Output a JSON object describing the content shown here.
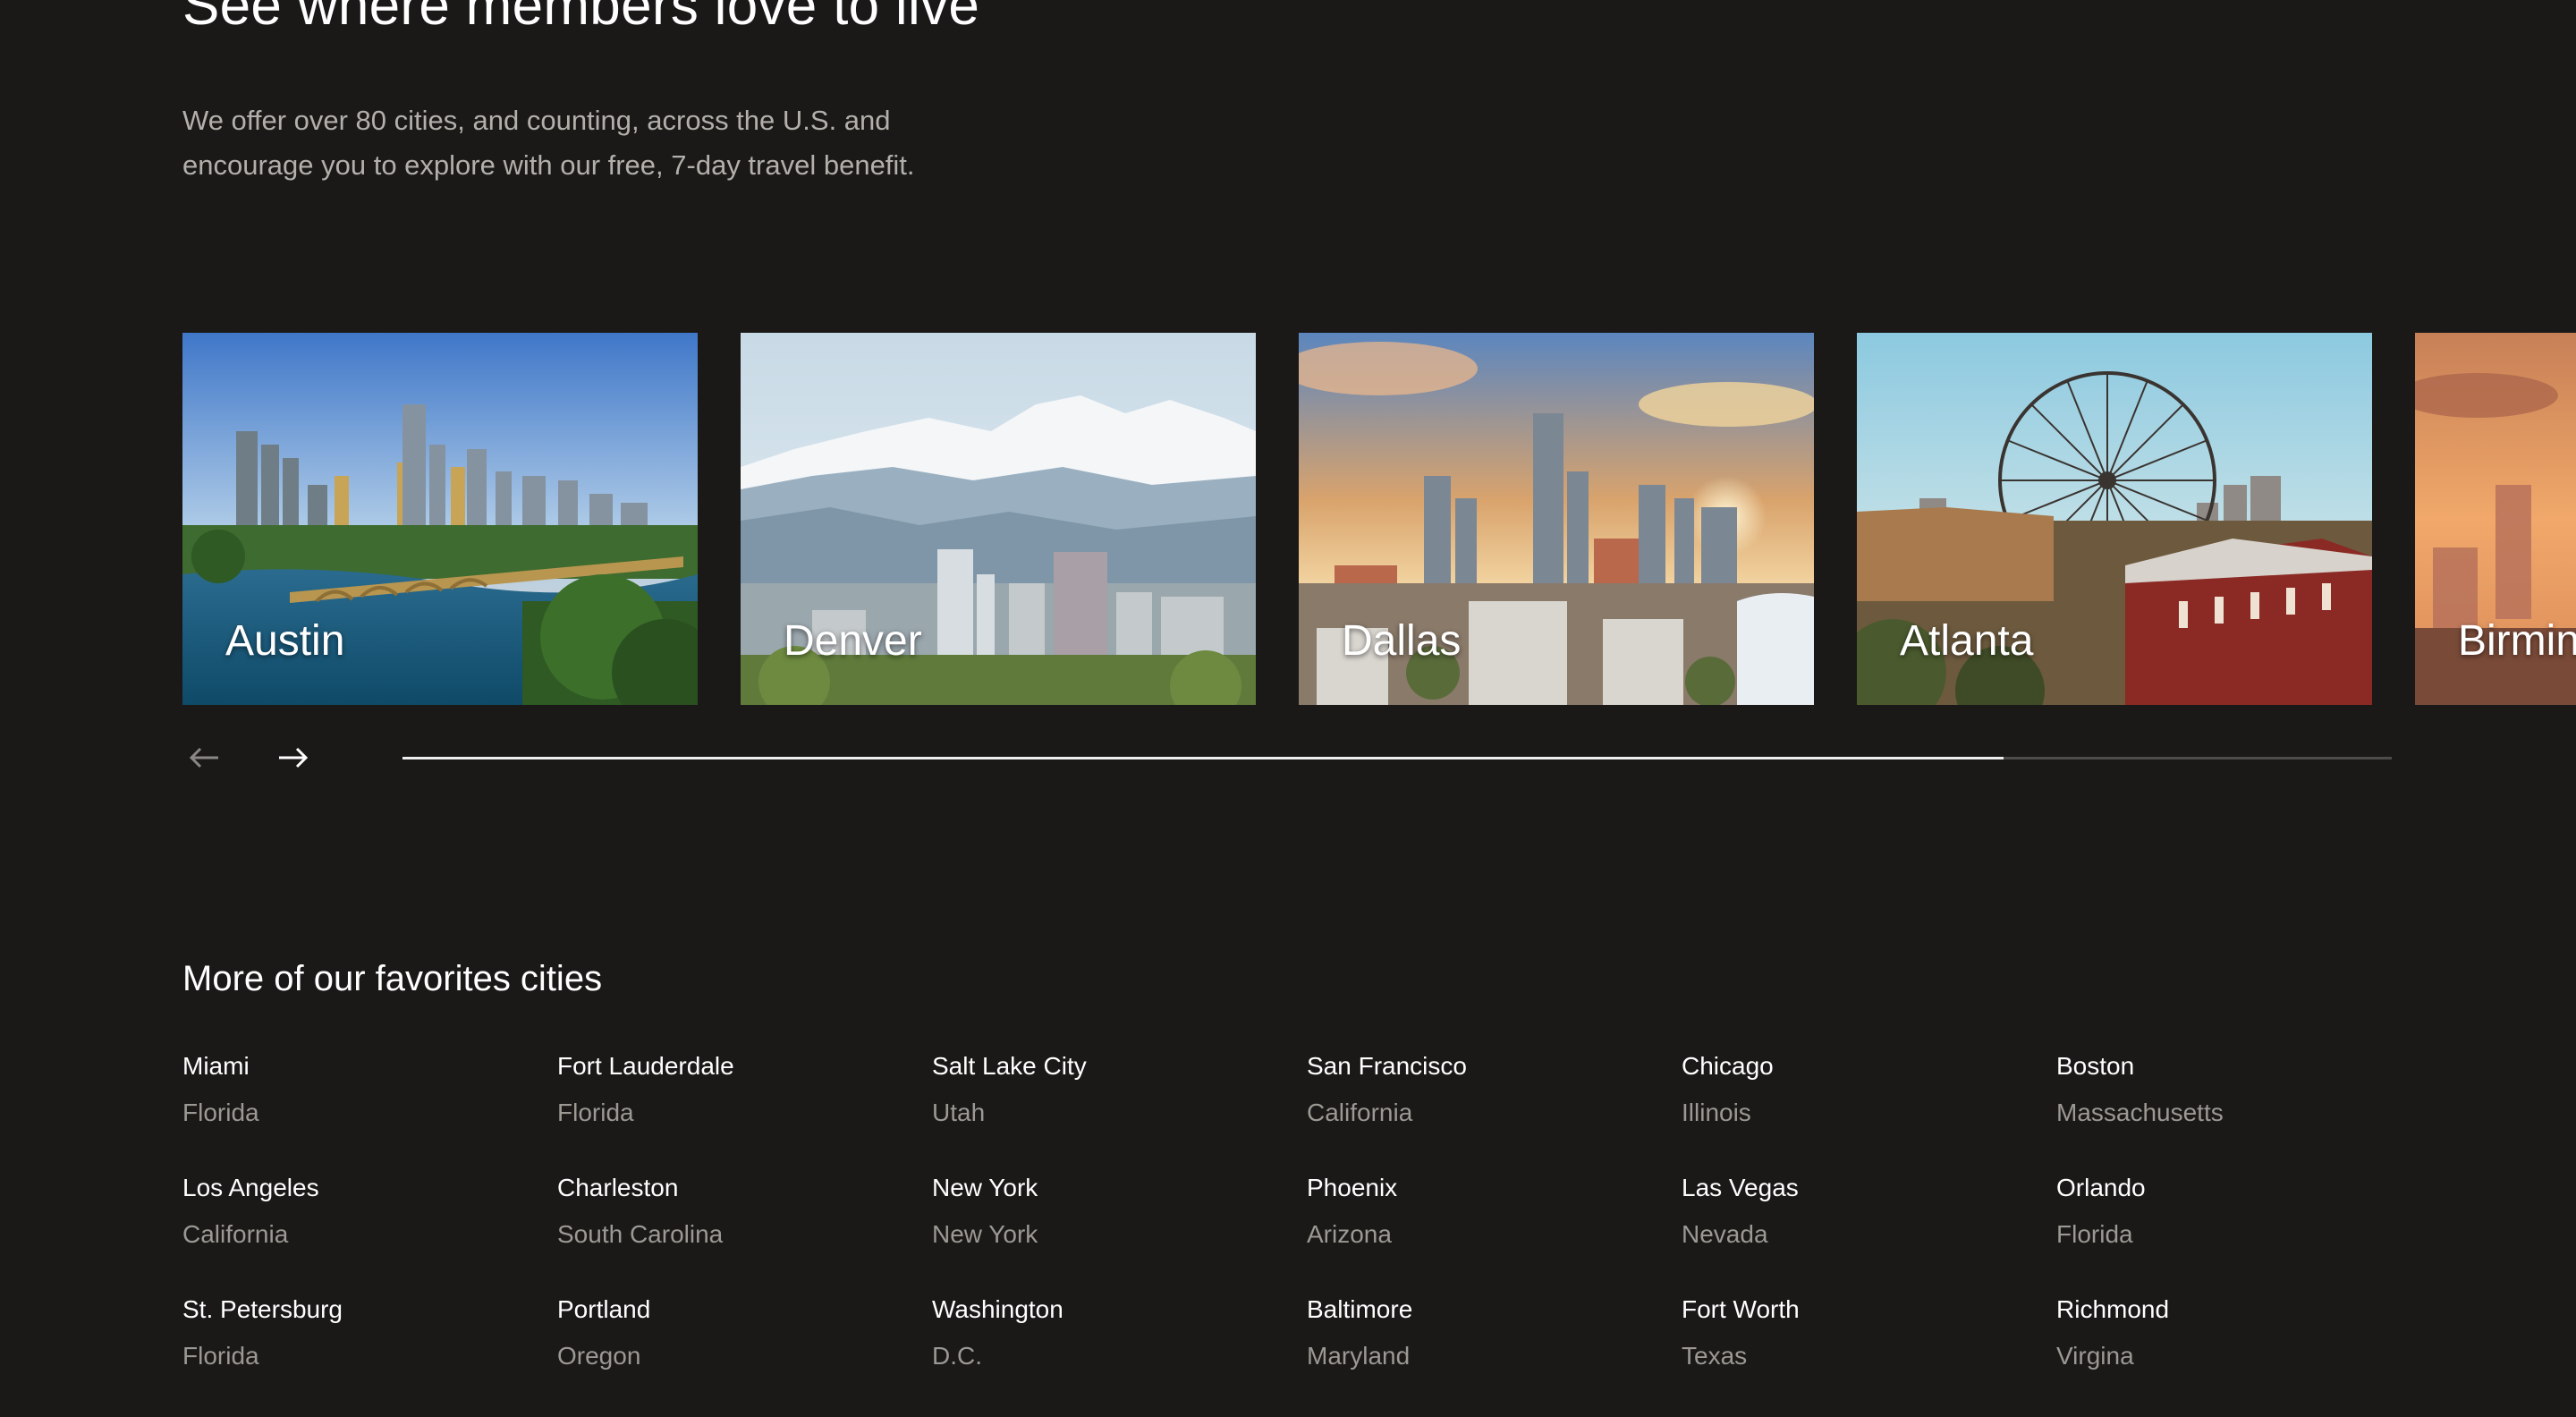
{
  "hero": {
    "title": "See where members love to live",
    "subtitle": "We offer over 80 cities, and counting, across the U.S. and encourage you to explore with our free, 7-day travel benefit."
  },
  "carousel": {
    "cards": [
      {
        "label": "Austin"
      },
      {
        "label": "Denver"
      },
      {
        "label": "Dallas"
      },
      {
        "label": "Atlanta"
      },
      {
        "label": "Birmin"
      }
    ],
    "prev_icon": "arrow-left-icon",
    "next_icon": "arrow-right-icon",
    "progress": 0.805
  },
  "favorites": {
    "title": "More of our favorites cities",
    "cities": [
      {
        "name": "Miami",
        "state": "Florida"
      },
      {
        "name": "Fort Lauderdale",
        "state": "Florida"
      },
      {
        "name": "Salt Lake City",
        "state": "Utah"
      },
      {
        "name": "San Francisco",
        "state": "California"
      },
      {
        "name": "Chicago",
        "state": "Illinois"
      },
      {
        "name": "Boston",
        "state": "Massachusetts"
      },
      {
        "name": "Los Angeles",
        "state": "California"
      },
      {
        "name": "Charleston",
        "state": "South Carolina"
      },
      {
        "name": "New York",
        "state": "New York"
      },
      {
        "name": "Phoenix",
        "state": "Arizona"
      },
      {
        "name": "Las Vegas",
        "state": "Nevada"
      },
      {
        "name": "Orlando",
        "state": "Florida"
      },
      {
        "name": "St. Petersburg",
        "state": "Florida"
      },
      {
        "name": "Portland",
        "state": "Oregon"
      },
      {
        "name": "Washington",
        "state": "D.C."
      },
      {
        "name": "Baltimore",
        "state": "Maryland"
      },
      {
        "name": "Fort Worth",
        "state": "Texas"
      },
      {
        "name": "Richmond",
        "state": "Virgina"
      }
    ]
  },
  "colors": {
    "background": "#1a1918",
    "text_primary": "#ffffff",
    "text_secondary": "#9c9893",
    "progress_fill": "#eeeeee",
    "progress_track": "#4e4c4a"
  }
}
